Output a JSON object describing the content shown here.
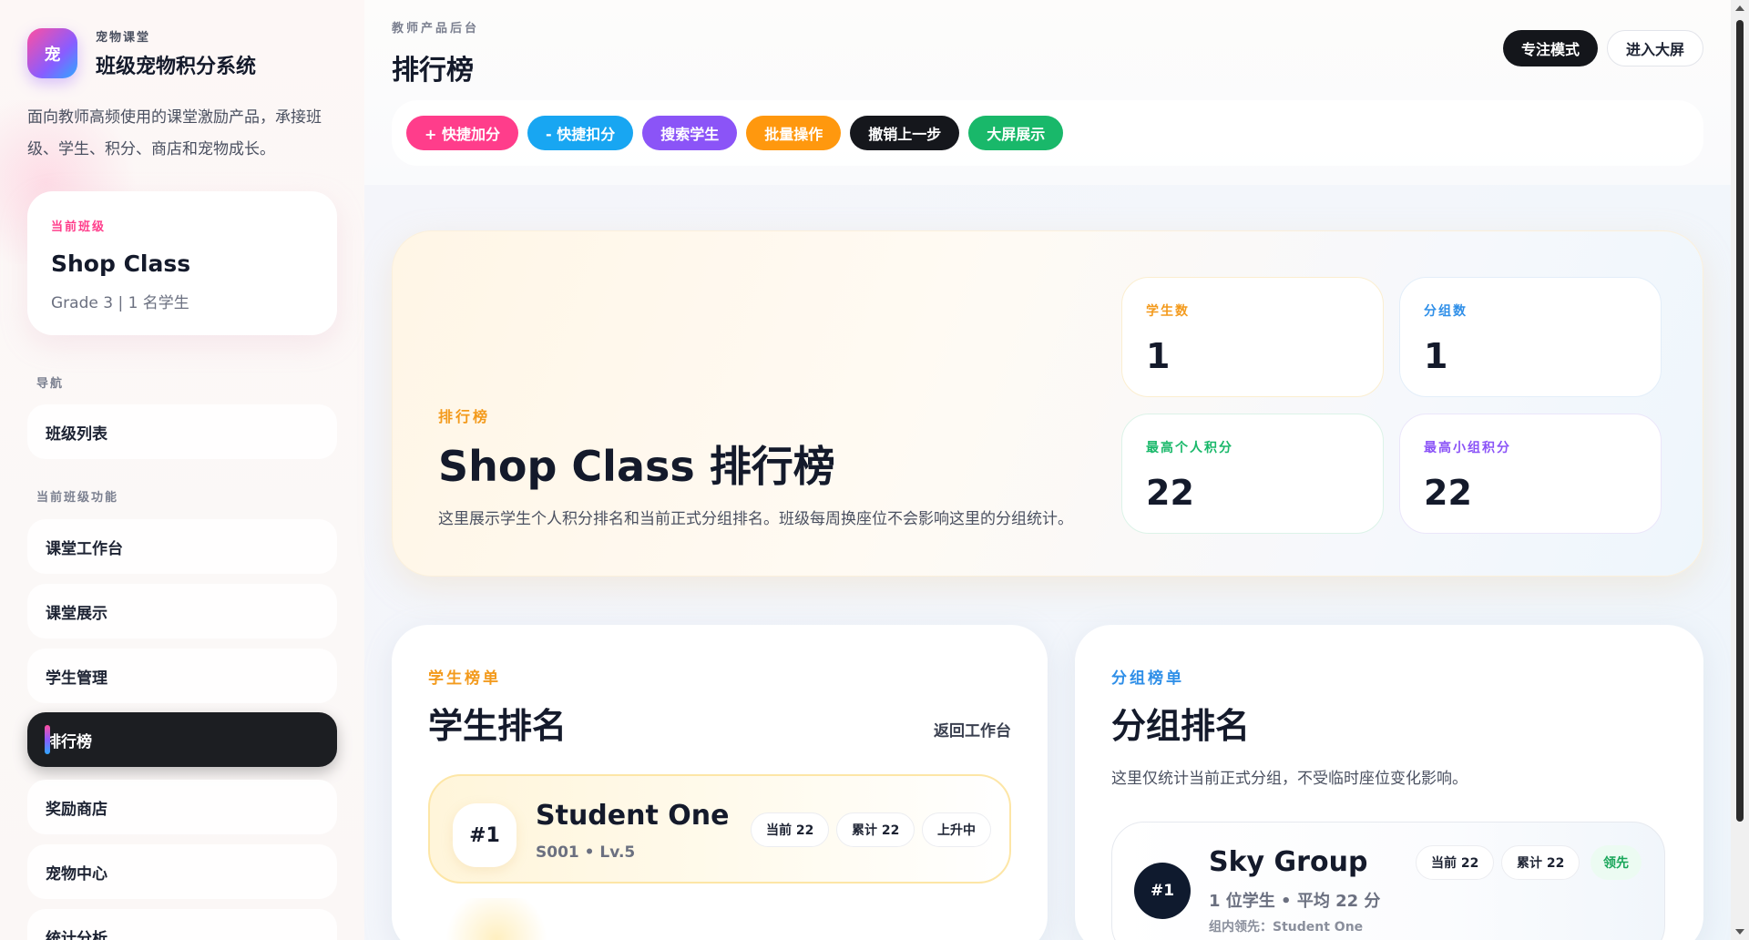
{
  "brand": {
    "logo_char": "宠",
    "subtitle": "宠物课堂",
    "title": "班级宠物积分系统",
    "description": "面向教师高频使用的课堂激励产品，承接班级、学生、积分、商店和宠物成长。"
  },
  "current_class": {
    "label": "当前班级",
    "name": "Shop Class",
    "meta": "Grade 3 | 1 名学生"
  },
  "nav": {
    "section_nav": "导航",
    "class_list": "班级列表",
    "section_class": "当前班级功能",
    "items": [
      "课堂工作台",
      "课堂展示",
      "学生管理",
      "排行榜",
      "奖励商店",
      "宠物中心",
      "统计分析"
    ]
  },
  "header": {
    "eyebrow": "教师产品后台",
    "title": "排行榜",
    "focus_mode": "专注模式",
    "big_screen": "进入大屏"
  },
  "quick_actions": [
    {
      "label": "+ 快捷加分",
      "color": "#ff3d8b"
    },
    {
      "label": "- 快捷扣分",
      "color": "#18a6f2"
    },
    {
      "label": "搜索学生",
      "color": "#8b54f7"
    },
    {
      "label": "批量操作",
      "color": "#ff980e"
    },
    {
      "label": "撤销上一步",
      "color": "#15171c"
    },
    {
      "label": "大屏展示",
      "color": "#19b86a"
    }
  ],
  "hero": {
    "eyebrow": "排行榜",
    "title": "Shop Class 排行榜",
    "description": "这里展示学生个人积分排名和当前正式分组排名。班级每周换座位不会影响这里的分组统计。"
  },
  "stats": [
    {
      "label": "学生数",
      "value": "1",
      "color": "#f39a1c",
      "border": "#fbeed0"
    },
    {
      "label": "分组数",
      "value": "1",
      "color": "#2f8fe8",
      "border": "#e3eef9"
    },
    {
      "label": "最高个人积分",
      "value": "22",
      "color": "#19b86a",
      "border": "#dcf3e8"
    },
    {
      "label": "最高小组积分",
      "value": "22",
      "color": "#8b54f7",
      "border": "#ebe6fa"
    }
  ],
  "student_panel": {
    "eyebrow": "学生榜单",
    "title": "学生排名",
    "back_link": "返回工作台",
    "rows": [
      {
        "rank": "#1",
        "name": "Student One",
        "meta": "S001 • Lv.5",
        "current": "当前 22",
        "total": "累计 22",
        "trend": "上升中"
      }
    ]
  },
  "group_panel": {
    "eyebrow": "分组榜单",
    "title": "分组排名",
    "description": "这里仅统计当前正式分组，不受临时座位变化影响。",
    "rows": [
      {
        "rank": "#1",
        "name": "Sky Group",
        "meta": "1 位学生 • 平均 22 分",
        "leader": "组内领先：Student One",
        "current": "当前 22",
        "total": "累计 22",
        "tag": "领先"
      }
    ]
  }
}
